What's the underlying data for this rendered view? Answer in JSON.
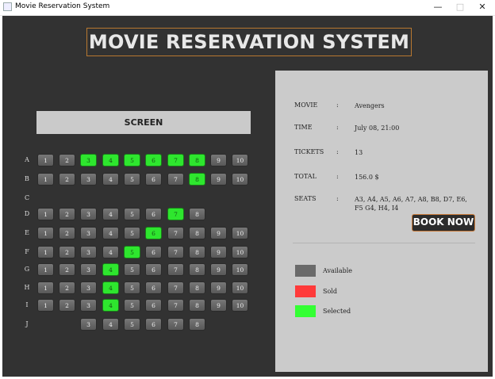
{
  "window": {
    "title": "Movie Reservation System",
    "minimize": "—",
    "maximize": "□",
    "close": "✕"
  },
  "app_title": "MOVIE RESERVATION SYSTEM",
  "screen_label": "SCREEN",
  "rows": [
    {
      "label": "A",
      "seats": [
        {
          "n": "1",
          "s": "available"
        },
        {
          "n": "2",
          "s": "available"
        },
        {
          "n": "3",
          "s": "selected"
        },
        {
          "n": "4",
          "s": "selected"
        },
        {
          "n": "5",
          "s": "selected"
        },
        {
          "n": "6",
          "s": "selected"
        },
        {
          "n": "7",
          "s": "selected"
        },
        {
          "n": "8",
          "s": "selected"
        },
        {
          "n": "9",
          "s": "available"
        },
        {
          "n": "10",
          "s": "available"
        }
      ]
    },
    {
      "label": "B",
      "seats": [
        {
          "n": "1",
          "s": "available"
        },
        {
          "n": "2",
          "s": "available"
        },
        {
          "n": "3",
          "s": "available"
        },
        {
          "n": "4",
          "s": "available"
        },
        {
          "n": "5",
          "s": "available"
        },
        {
          "n": "6",
          "s": "available"
        },
        {
          "n": "7",
          "s": "available"
        },
        {
          "n": "8",
          "s": "selected"
        },
        {
          "n": "9",
          "s": "available"
        },
        {
          "n": "10",
          "s": "available"
        }
      ]
    },
    {
      "label": "C",
      "seats": []
    },
    {
      "label": "D",
      "seats": [
        {
          "n": "1",
          "s": "available"
        },
        {
          "n": "2",
          "s": "available"
        },
        {
          "n": "3",
          "s": "available"
        },
        {
          "n": "4",
          "s": "available"
        },
        {
          "n": "5",
          "s": "available"
        },
        {
          "n": "6",
          "s": "available"
        },
        {
          "n": "7",
          "s": "selected"
        },
        {
          "n": "8",
          "s": "available"
        }
      ]
    },
    {
      "label": "E",
      "seats": [
        {
          "n": "1",
          "s": "available"
        },
        {
          "n": "2",
          "s": "available"
        },
        {
          "n": "3",
          "s": "available"
        },
        {
          "n": "4",
          "s": "available"
        },
        {
          "n": "5",
          "s": "available"
        },
        {
          "n": "6",
          "s": "selected"
        },
        {
          "n": "7",
          "s": "available"
        },
        {
          "n": "8",
          "s": "available"
        },
        {
          "n": "9",
          "s": "available"
        },
        {
          "n": "10",
          "s": "available"
        }
      ]
    },
    {
      "label": "F",
      "seats": [
        {
          "n": "1",
          "s": "available"
        },
        {
          "n": "2",
          "s": "available"
        },
        {
          "n": "3",
          "s": "available"
        },
        {
          "n": "4",
          "s": "available"
        },
        {
          "n": "5",
          "s": "selected"
        },
        {
          "n": "6",
          "s": "available"
        },
        {
          "n": "7",
          "s": "available"
        },
        {
          "n": "8",
          "s": "available"
        },
        {
          "n": "9",
          "s": "available"
        },
        {
          "n": "10",
          "s": "available"
        }
      ]
    },
    {
      "label": "G",
      "seats": [
        {
          "n": "1",
          "s": "available"
        },
        {
          "n": "2",
          "s": "available"
        },
        {
          "n": "3",
          "s": "available"
        },
        {
          "n": "4",
          "s": "selected"
        },
        {
          "n": "5",
          "s": "available"
        },
        {
          "n": "6",
          "s": "available"
        },
        {
          "n": "7",
          "s": "available"
        },
        {
          "n": "8",
          "s": "available"
        },
        {
          "n": "9",
          "s": "available"
        },
        {
          "n": "10",
          "s": "available"
        }
      ]
    },
    {
      "label": "H",
      "seats": [
        {
          "n": "1",
          "s": "available"
        },
        {
          "n": "2",
          "s": "available"
        },
        {
          "n": "3",
          "s": "available"
        },
        {
          "n": "4",
          "s": "selected"
        },
        {
          "n": "5",
          "s": "available"
        },
        {
          "n": "6",
          "s": "available"
        },
        {
          "n": "7",
          "s": "available"
        },
        {
          "n": "8",
          "s": "available"
        },
        {
          "n": "9",
          "s": "available"
        },
        {
          "n": "10",
          "s": "available"
        }
      ]
    },
    {
      "label": "I",
      "seats": [
        {
          "n": "1",
          "s": "available"
        },
        {
          "n": "2",
          "s": "available"
        },
        {
          "n": "3",
          "s": "available"
        },
        {
          "n": "4",
          "s": "selected"
        },
        {
          "n": "5",
          "s": "available"
        },
        {
          "n": "6",
          "s": "available"
        },
        {
          "n": "7",
          "s": "available"
        },
        {
          "n": "8",
          "s": "available"
        },
        {
          "n": "9",
          "s": "available"
        },
        {
          "n": "10",
          "s": "available"
        }
      ]
    },
    {
      "label": "J",
      "seats": [
        {
          "n": "3",
          "s": "available"
        },
        {
          "n": "4",
          "s": "available"
        },
        {
          "n": "5",
          "s": "available"
        },
        {
          "n": "6",
          "s": "available"
        },
        {
          "n": "7",
          "s": "available"
        },
        {
          "n": "8",
          "s": "available"
        }
      ]
    }
  ],
  "summary": [
    {
      "label": "MOVIE",
      "value": "Avengers"
    },
    {
      "label": "TIME",
      "value": "July 08, 21:00"
    },
    {
      "label": "TICKETS",
      "value": "13"
    },
    {
      "label": "TOTAL",
      "value": "156.0 $"
    },
    {
      "label": "SEATS",
      "value": "A3, A4, A5, A6, A7, A8, B8, D7, E6, F5 G4, H4, I4"
    }
  ],
  "colon": ":",
  "book_button": "BOOK NOW",
  "legend": [
    {
      "label": "Available",
      "color": "#6a6a6a"
    },
    {
      "label": "Sold",
      "color": "#ff3a3a"
    },
    {
      "label": "Selected",
      "color": "#33ff33"
    }
  ],
  "colors": {
    "background": "#323232",
    "panel": "#cbcbcb",
    "accent_border": "#b87830",
    "selected_seat": "#2ee62e"
  }
}
